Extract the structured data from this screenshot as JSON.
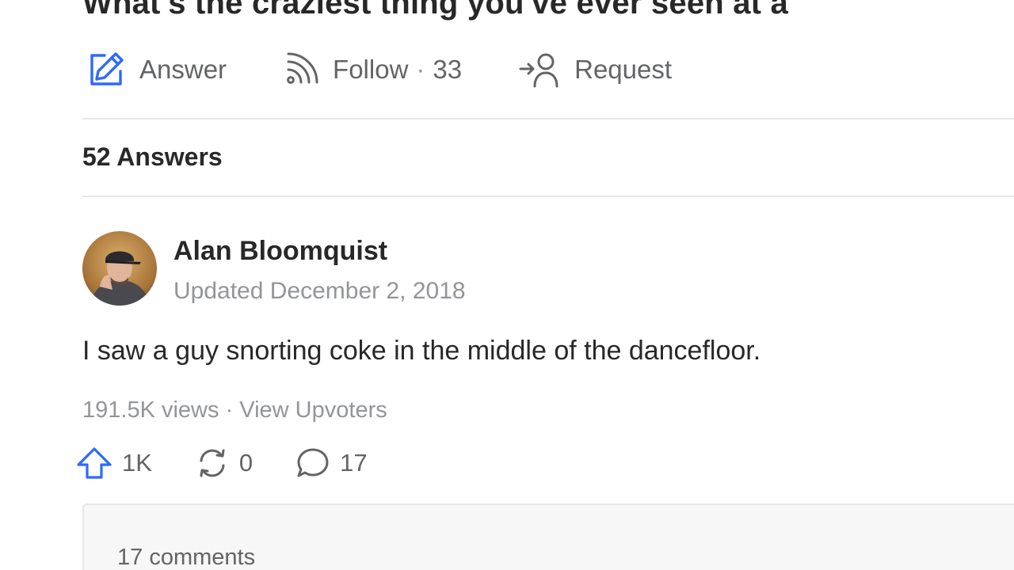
{
  "question": {
    "title": "What's the craziest thing you've ever seen at a"
  },
  "actions": {
    "answer_label": "Answer",
    "follow_label": "Follow",
    "follow_separator": "·",
    "follow_count": "33",
    "request_label": "Request"
  },
  "answers_header": "52 Answers",
  "answer": {
    "author_name": "Alan Bloomquist",
    "updated_text": "Updated December 2, 2018",
    "body": "I saw a guy snorting coke in the middle of the dancefloor.",
    "views": "191.5K views",
    "stats_separator": "·",
    "view_upvoters_label": "View Upvoters",
    "upvotes": "1K",
    "shares": "0",
    "comments_count": "17"
  },
  "comments": {
    "label": "17 comments"
  },
  "colors": {
    "accent": "#2e69ff",
    "text_primary": "#282829",
    "text_secondary": "#636466",
    "text_muted": "#939598",
    "divider": "#e6e7e8"
  },
  "icons": {
    "answer": "pencil-square-icon",
    "follow": "rss-feed-icon",
    "request": "person-add-icon",
    "upvote": "up-arrow-icon",
    "share": "share-cycle-icon",
    "comment": "speech-bubble-icon"
  }
}
